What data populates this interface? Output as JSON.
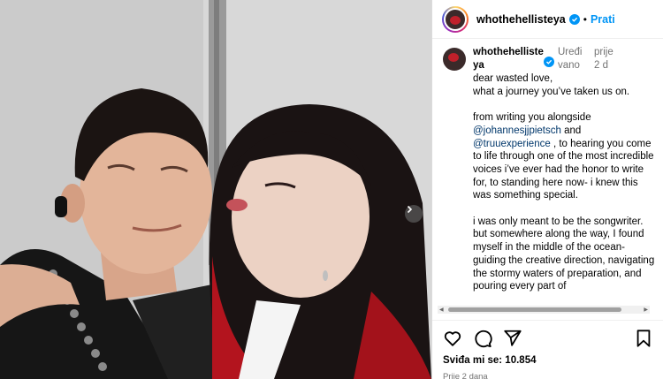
{
  "post": {
    "username": "whothehellisteya",
    "follow_label": "Prati",
    "dot": "•",
    "edited_label": "Uređivano",
    "time_short": "prije 2 d",
    "likes_label": "Sviđa mi se: 10.854",
    "time_long": "Prije 2 dana"
  },
  "caption": {
    "p1_line1": "dear wasted love,",
    "p1_line2": "what a journey you’ve taken us on.",
    "p2_a": "from writing you alongside ",
    "mention1": "@johannesjjpietsch",
    "p2_b": " and ",
    "mention2": "@truuexperience",
    "p2_c": " , to hearing you come to life through one of the most incredible voices i’ve ever had the honor to write for, to standing here now- i knew this was something special.",
    "p3": "i was only meant to be the songwriter. but somewhere along the way, I found myself in the middle of the ocean- guiding the creative direction, navigating the stormy waters of preparation, and pouring every part of"
  },
  "icons": {
    "verified": "verified-badge-icon",
    "like": "heart-icon",
    "comment": "comment-icon",
    "share": "send-icon",
    "save": "bookmark-icon",
    "next": "chevron-right-icon"
  },
  "colors": {
    "accent": "#0095f6",
    "mention": "#00376b",
    "muted": "#737373"
  }
}
